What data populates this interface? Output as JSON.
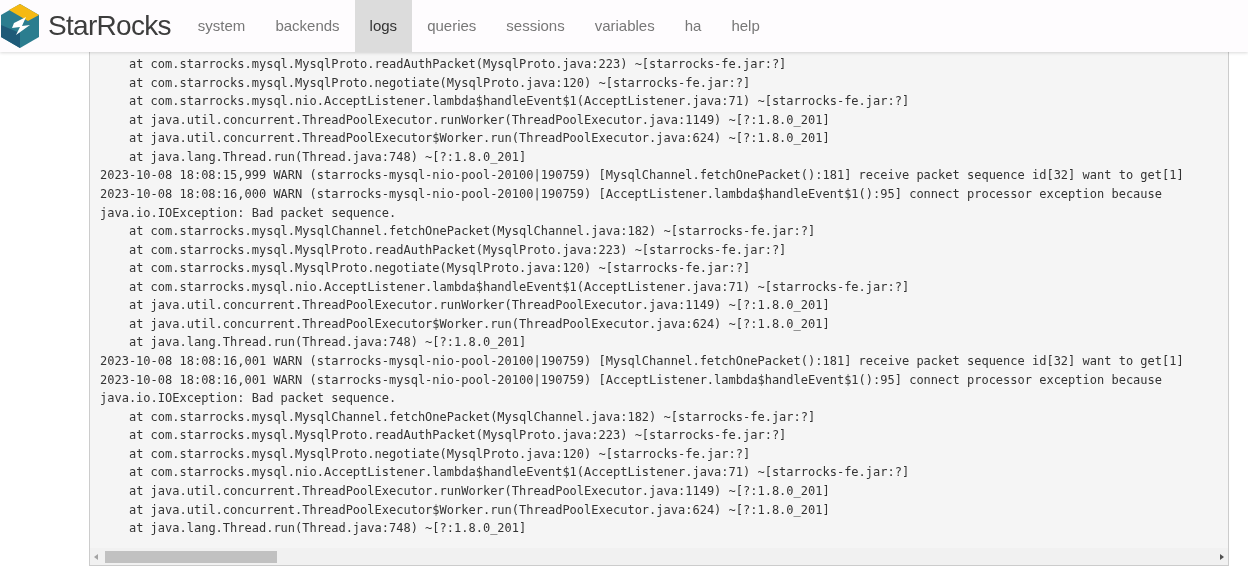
{
  "brand": {
    "name": "StarRocks"
  },
  "nav": [
    {
      "label": "system",
      "selected": false
    },
    {
      "label": "backends",
      "selected": false
    },
    {
      "label": "logs",
      "selected": true
    },
    {
      "label": "queries",
      "selected": false
    },
    {
      "label": "sessions",
      "selected": false
    },
    {
      "label": "variables",
      "selected": false
    },
    {
      "label": "ha",
      "selected": false
    },
    {
      "label": "help",
      "selected": false
    }
  ],
  "log_lines": [
    "\tat com.starrocks.mysql.MysqlProto.readAuthPacket(MysqlProto.java:223) ~[starrocks-fe.jar:?]",
    "\tat com.starrocks.mysql.MysqlProto.negotiate(MysqlProto.java:120) ~[starrocks-fe.jar:?]",
    "\tat com.starrocks.mysql.nio.AcceptListener.lambda$handleEvent$1(AcceptListener.java:71) ~[starrocks-fe.jar:?]",
    "\tat java.util.concurrent.ThreadPoolExecutor.runWorker(ThreadPoolExecutor.java:1149) ~[?:1.8.0_201]",
    "\tat java.util.concurrent.ThreadPoolExecutor$Worker.run(ThreadPoolExecutor.java:624) ~[?:1.8.0_201]",
    "\tat java.lang.Thread.run(Thread.java:748) ~[?:1.8.0_201]",
    "2023-10-08 18:08:15,999 WARN (starrocks-mysql-nio-pool-20100|190759) [MysqlChannel.fetchOnePacket():181] receive packet sequence id[32] want to get[1]",
    "2023-10-08 18:08:16,000 WARN (starrocks-mysql-nio-pool-20100|190759) [AcceptListener.lambda$handleEvent$1():95] connect processor exception because",
    "java.io.IOException: Bad packet sequence.",
    "\tat com.starrocks.mysql.MysqlChannel.fetchOnePacket(MysqlChannel.java:182) ~[starrocks-fe.jar:?]",
    "\tat com.starrocks.mysql.MysqlProto.readAuthPacket(MysqlProto.java:223) ~[starrocks-fe.jar:?]",
    "\tat com.starrocks.mysql.MysqlProto.negotiate(MysqlProto.java:120) ~[starrocks-fe.jar:?]",
    "\tat com.starrocks.mysql.nio.AcceptListener.lambda$handleEvent$1(AcceptListener.java:71) ~[starrocks-fe.jar:?]",
    "\tat java.util.concurrent.ThreadPoolExecutor.runWorker(ThreadPoolExecutor.java:1149) ~[?:1.8.0_201]",
    "\tat java.util.concurrent.ThreadPoolExecutor$Worker.run(ThreadPoolExecutor.java:624) ~[?:1.8.0_201]",
    "\tat java.lang.Thread.run(Thread.java:748) ~[?:1.8.0_201]",
    "2023-10-08 18:08:16,001 WARN (starrocks-mysql-nio-pool-20100|190759) [MysqlChannel.fetchOnePacket():181] receive packet sequence id[32] want to get[1]",
    "2023-10-08 18:08:16,001 WARN (starrocks-mysql-nio-pool-20100|190759) [AcceptListener.lambda$handleEvent$1():95] connect processor exception because",
    "java.io.IOException: Bad packet sequence.",
    "\tat com.starrocks.mysql.MysqlChannel.fetchOnePacket(MysqlChannel.java:182) ~[starrocks-fe.jar:?]",
    "\tat com.starrocks.mysql.MysqlProto.readAuthPacket(MysqlProto.java:223) ~[starrocks-fe.jar:?]",
    "\tat com.starrocks.mysql.MysqlProto.negotiate(MysqlProto.java:120) ~[starrocks-fe.jar:?]",
    "\tat com.starrocks.mysql.nio.AcceptListener.lambda$handleEvent$1(AcceptListener.java:71) ~[starrocks-fe.jar:?]",
    "\tat java.util.concurrent.ThreadPoolExecutor.runWorker(ThreadPoolExecutor.java:1149) ~[?:1.8.0_201]",
    "\tat java.util.concurrent.ThreadPoolExecutor$Worker.run(ThreadPoolExecutor.java:624) ~[?:1.8.0_201]",
    "\tat java.lang.Thread.run(Thread.java:748) ~[?:1.8.0_201]"
  ]
}
